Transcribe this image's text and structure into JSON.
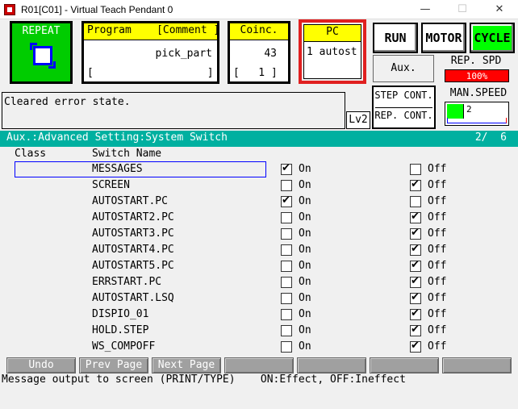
{
  "window": {
    "title": "R01[C01] - Virtual Teach Pendant 0",
    "minimize": "—",
    "maximize": "☐",
    "close": "✕"
  },
  "status": {
    "repeat_label": "REPEAT",
    "program": {
      "header": "Program    [Comment ]",
      "name": "pick_part",
      "comment": "[                  ]"
    },
    "coinc": {
      "header": "Coinc.",
      "value": "43",
      "step": "[   1 ]"
    },
    "pc": {
      "header": "PC",
      "value": "1 autost"
    },
    "run_label": "RUN",
    "motor_label": "MOTOR",
    "cycle_label": "CYCLE",
    "aux_label": "Aux.",
    "rep_spd_label": "REP. SPD",
    "rep_spd_value": "100%",
    "step_cont_label": "STEP CONT.",
    "rep_cont_label": "REP. CONT.",
    "man_speed_label": "MAN.SPEED",
    "man_speed_value": "2",
    "message": "Cleared error state.",
    "level": "Lv2"
  },
  "list": {
    "title": "Aux.:Advanced Setting:System Switch",
    "page": "2/  6",
    "col_class": "Class",
    "col_switch": "Switch Name",
    "on_label": "On",
    "off_label": "Off",
    "rows": [
      {
        "name": "MESSAGES",
        "on": true,
        "off": false,
        "selected": true
      },
      {
        "name": "SCREEN",
        "on": false,
        "off": true
      },
      {
        "name": "AUTOSTART.PC",
        "on": true,
        "off": false
      },
      {
        "name": "AUTOSTART2.PC",
        "on": false,
        "off": true
      },
      {
        "name": "AUTOSTART3.PC",
        "on": false,
        "off": true
      },
      {
        "name": "AUTOSTART4.PC",
        "on": false,
        "off": true
      },
      {
        "name": "AUTOSTART5.PC",
        "on": false,
        "off": true
      },
      {
        "name": "ERRSTART.PC",
        "on": false,
        "off": true
      },
      {
        "name": "AUTOSTART.LSQ",
        "on": false,
        "off": true
      },
      {
        "name": "DISPIO_01",
        "on": false,
        "off": true
      },
      {
        "name": "HOLD.STEP",
        "on": false,
        "off": true
      },
      {
        "name": "WS_COMPOFF",
        "on": false,
        "off": true
      }
    ]
  },
  "footer": {
    "buttons": [
      "Undo",
      "Prev Page",
      "Next Page",
      "",
      "",
      "",
      ""
    ],
    "message": "Message output to screen (PRINT/TYPE)    ON:Effect, OFF:Ineffect"
  },
  "colors": {
    "accent": "#00b0a0",
    "repeat_bg": "#00cc00",
    "cycle_bg": "#00ff00",
    "pc_border": "#e02020",
    "header_yellow": "#ffff00"
  }
}
